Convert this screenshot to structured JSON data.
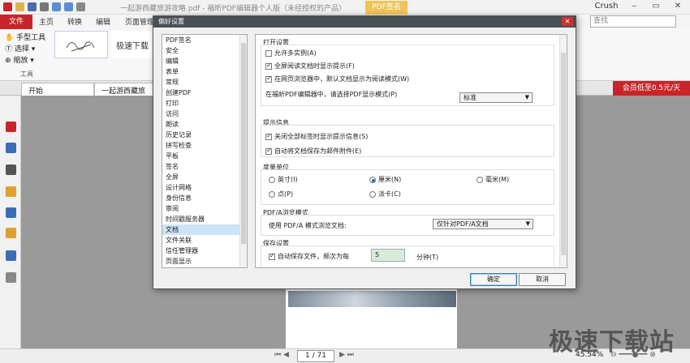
{
  "window": {
    "title": "一起游西藏旅游攻略.pdf - 福昕PDF编辑器个人版（未经授权的产品）",
    "context_tab": "PDF签名",
    "user": "Crush",
    "controls": [
      "‒",
      "▭",
      "✕"
    ]
  },
  "ribbon_tabs": [
    "文件",
    "主页",
    "转换",
    "编辑",
    "页面管理"
  ],
  "search_placeholder": "查找",
  "tools": {
    "items": [
      "手型工具",
      "选择",
      "缩放"
    ],
    "group_label": "工具",
    "sig_text": "极速下载"
  },
  "doc_tabs": {
    "start": "开始",
    "doc": "一起游西藏旅游",
    "vip": "会员低至0.5元/天"
  },
  "dialog": {
    "title": "偏好设置",
    "close": "✕",
    "categories": [
      "PDF签名",
      "安全",
      "编辑",
      "表单",
      "常规",
      "创建PDF",
      "打印",
      "访问",
      "朗读",
      "历史记录",
      "拼写检查",
      "平板",
      "签名",
      "全屏",
      "设计网格",
      "身份信息",
      "审阅",
      "时间戳服务器",
      "文档",
      "文件关联",
      "信任管理器",
      "页面显示"
    ],
    "selected_category": "文档",
    "open_settings": {
      "title": "打开设置",
      "allow_multi": "允许多实例(A)",
      "fullscreen_prompt": "全屏阅读文档时显示提示(F)",
      "browser_read_mode": "在网页浏览器中，默认文档显示为阅读模式(W)",
      "mode_label": "在福昕PDF编辑器中，请选择PDF显示模式(P)",
      "mode_value": "标准"
    },
    "tips": {
      "title": "提示信息",
      "close_sign_tip": "关闭全部标签时显示提示信息(S)",
      "auto_save_attachment": "自动将文档保存为邮件附件(E)"
    },
    "units": {
      "title": "度量单位",
      "options": [
        "英寸(I)",
        "厘米(N)",
        "毫米(M)",
        "点(P)",
        "派卡(C)"
      ],
      "selected": "厘米(N)"
    },
    "pdfa": {
      "title": "PDF/A浏览模式",
      "label": "使用 PDF/A 模式浏览文档:",
      "value": "仅针对PDF/A文档"
    },
    "save": {
      "title": "保存设置",
      "auto_save": "自动保存文件，频次为每",
      "interval": "5",
      "unit": "分钟(T)"
    },
    "ok": "确定",
    "cancel": "取消"
  },
  "status": {
    "page": "1 / 71",
    "zoom": "45.54%"
  },
  "watermark": "极速下载站"
}
